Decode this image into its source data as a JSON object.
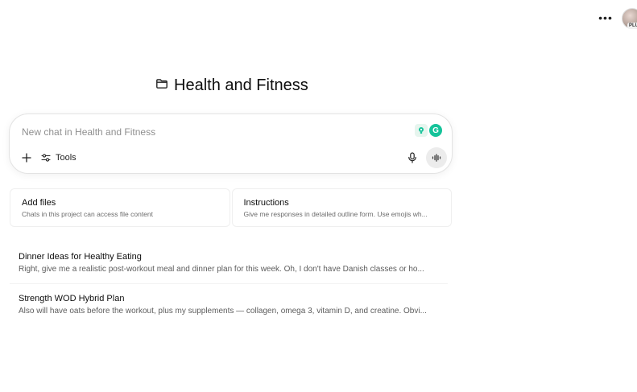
{
  "header": {
    "more_label": "•••",
    "plus_badge": "PLUS"
  },
  "project": {
    "title": "Health and Fitness",
    "icon": "folder-icon"
  },
  "composer": {
    "placeholder": "New chat in Health and Fitness",
    "value": "",
    "tools_label": "Tools",
    "extension_g_label": "G"
  },
  "cards": [
    {
      "title": "Add files",
      "subtitle": "Chats in this project can access file content"
    },
    {
      "title": "Instructions",
      "subtitle": "Give me responses in detailed outline form. Use emojis wh..."
    }
  ],
  "chats": [
    {
      "title": "Dinner Ideas for Healthy Eating",
      "snippet": "Right, give me a realistic post-workout meal and dinner plan for this week. Oh, I don't have Danish classes or ho..."
    },
    {
      "title": "Strength WOD Hybrid Plan",
      "snippet": "Also will have oats before the workout, plus my supplements — collagen, omega 3, vitamin D, and creatine. Obvi..."
    }
  ],
  "colors": {
    "accent_green": "#15c39a",
    "text_primary": "#0d0d0d",
    "text_secondary": "#6b6b6b",
    "border": "#e3e3e3"
  }
}
